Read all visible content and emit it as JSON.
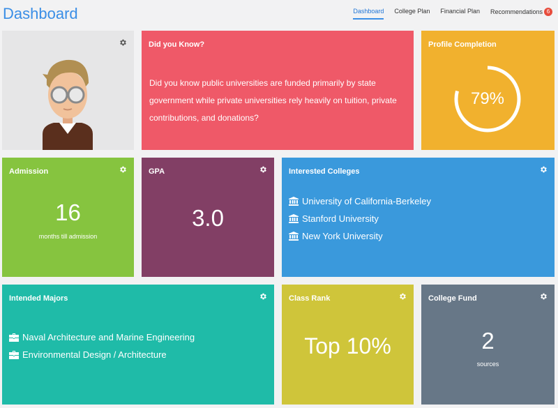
{
  "header": {
    "title": "Dashboard",
    "nav": [
      {
        "label": "Dashboard",
        "active": true
      },
      {
        "label": "College Plan"
      },
      {
        "label": "Financial Plan"
      },
      {
        "label": "Recommendations",
        "badge": "6"
      }
    ]
  },
  "did_you_know": {
    "title": "Did you Know?",
    "text": "Did you know public universities are funded primarily by state government while private universities rely heavily on tuition, private contributions, and donations?"
  },
  "profile": {
    "title": "Profile Completion",
    "percent_label": "79%",
    "percent": 0.79
  },
  "admission": {
    "title": "Admission",
    "value": "16",
    "subtitle": "months till admission"
  },
  "gpa": {
    "title": "GPA",
    "value": "3.0"
  },
  "colleges": {
    "title": "Interested Colleges",
    "items": [
      "University of California-Berkeley",
      "Stanford University",
      "New York University"
    ]
  },
  "majors": {
    "title": "Intended Majors",
    "items": [
      "Naval Architecture and Marine Engineering",
      "Environmental Design / Architecture"
    ]
  },
  "class_rank": {
    "title": "Class Rank",
    "value": "Top 10%"
  },
  "college_fund": {
    "title": "College Fund",
    "value": "2",
    "subtitle": "sources"
  },
  "colors": {
    "accent": "#3a8ee6",
    "did_you_know": "#ef5968",
    "profile": "#f1b12e",
    "admission": "#86c43f",
    "gpa": "#823f65",
    "colleges": "#3a99dc",
    "majors": "#1fbba8",
    "class_rank": "#cfc53a",
    "college_fund": "#677787"
  }
}
